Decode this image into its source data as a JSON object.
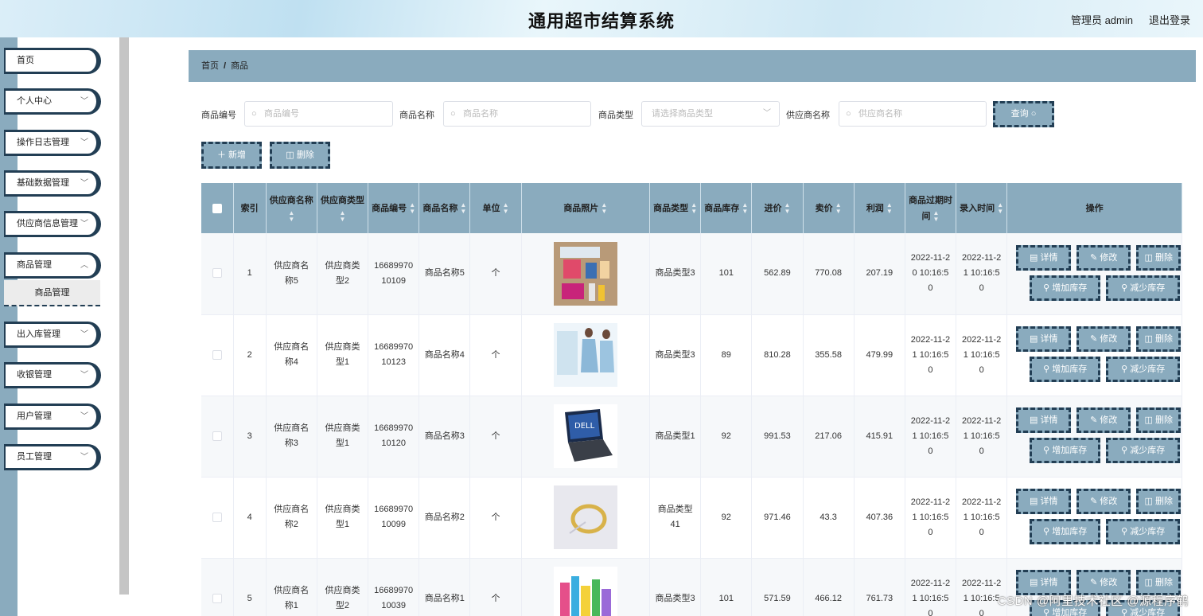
{
  "header": {
    "title": "通用超市结算系统",
    "user": "管理员 admin",
    "logout": "退出登录"
  },
  "sidebar": {
    "items": [
      {
        "label": "首页",
        "chevron": false
      },
      {
        "label": "个人中心",
        "chevron": true
      },
      {
        "label": "操作日志管理",
        "chevron": true
      },
      {
        "label": "基础数据管理",
        "chevron": true
      },
      {
        "label": "供应商信息管理",
        "chevron": true
      },
      {
        "label": "商品管理",
        "chevron": true
      },
      {
        "label": "出入库管理",
        "chevron": true
      },
      {
        "label": "收银管理",
        "chevron": true
      },
      {
        "label": "用户管理",
        "chevron": true
      },
      {
        "label": "员工管理",
        "chevron": true
      }
    ],
    "sub_item": "商品管理"
  },
  "breadcrumb": {
    "home": "首页",
    "sep": "/",
    "current": "商品"
  },
  "search": {
    "code_label": "商品编号",
    "code_placeholder": "商品编号",
    "name_label": "商品名称",
    "name_placeholder": "商品名称",
    "type_label": "商品类型",
    "type_placeholder": "请选择商品类型",
    "supplier_label": "供应商名称",
    "supplier_placeholder": "供应商名称",
    "query_label": "查询"
  },
  "actions": {
    "add_label": "新增",
    "delete_label": "删除"
  },
  "table": {
    "headers": {
      "index": "索引",
      "supplier": "供应商名称",
      "supplier_type": "供应商类型",
      "code": "商品编号",
      "name": "商品名称",
      "unit": "单位",
      "photo": "商品照片",
      "type": "商品类型",
      "stock": "商品库存",
      "cost": "进价",
      "price": "卖价",
      "profit": "利润",
      "expire": "商品过期时间",
      "entry": "录入时间",
      "ops": "操作"
    },
    "op_labels": {
      "detail": "详情",
      "edit": "修改",
      "delete": "删除",
      "add_stock": "增加库存",
      "reduce_stock": "减少库存"
    },
    "rows": [
      {
        "index": "1",
        "supplier": "供应商名称5",
        "supplier_type": "供应商类型2",
        "code": "1668997010109",
        "name": "商品名称5",
        "unit": "个",
        "type": "商品类型3",
        "stock": "101",
        "cost": "562.89",
        "price": "770.08",
        "profit": "207.19",
        "expire": "2022-11-20 10:16:50",
        "entry": "2022-11-21 10:16:50"
      },
      {
        "index": "2",
        "supplier": "供应商名称4",
        "supplier_type": "供应商类型1",
        "code": "1668997010123",
        "name": "商品名称4",
        "unit": "个",
        "type": "商品类型3",
        "stock": "89",
        "cost": "810.28",
        "price": "355.58",
        "profit": "479.99",
        "expire": "2022-11-21 10:16:50",
        "entry": "2022-11-21 10:16:50"
      },
      {
        "index": "3",
        "supplier": "供应商名称3",
        "supplier_type": "供应商类型1",
        "code": "1668997010120",
        "name": "商品名称3",
        "unit": "个",
        "type": "商品类型1",
        "stock": "92",
        "cost": "991.53",
        "price": "217.06",
        "profit": "415.91",
        "expire": "2022-11-21 10:16:50",
        "entry": "2022-11-21 10:16:50"
      },
      {
        "index": "4",
        "supplier": "供应商名称2",
        "supplier_type": "供应商类型1",
        "code": "1668997010099",
        "name": "商品名称2",
        "unit": "个",
        "type": "商品类型41",
        "stock": "92",
        "cost": "971.46",
        "price": "43.3",
        "profit": "407.36",
        "expire": "2022-11-21 10:16:50",
        "entry": "2022-11-21 10:16:50"
      },
      {
        "index": "5",
        "supplier": "供应商名称1",
        "supplier_type": "供应商类型2",
        "code": "1668997010039",
        "name": "商品名称1",
        "unit": "个",
        "type": "商品类型3",
        "stock": "101",
        "cost": "571.59",
        "price": "466.12",
        "profit": "761.73",
        "expire": "2022-11-21 10:16:50",
        "entry": "2022-11-21 10:16:50"
      }
    ]
  },
  "watermark": "CSDN @阿里技术社区 @源程序鹤",
  "colors": {
    "accent": "#8aabbe",
    "border_dark": "#223e54"
  }
}
